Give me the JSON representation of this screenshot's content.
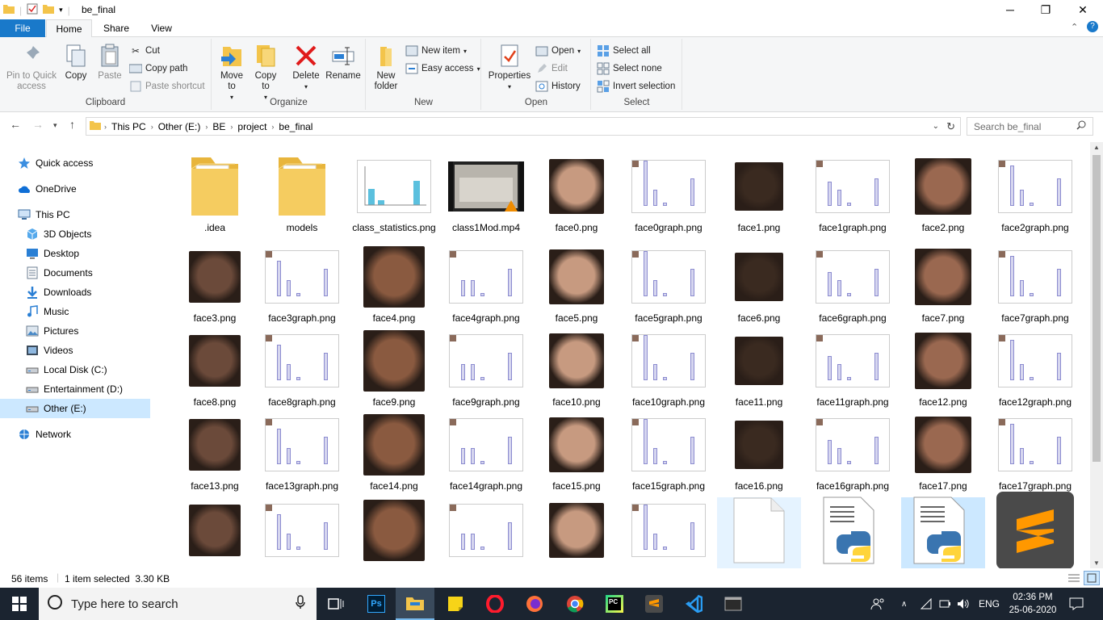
{
  "window": {
    "title": "be_final",
    "minimize": "─",
    "restore": "❐",
    "close": "✕"
  },
  "tabs": [
    {
      "label": "File"
    },
    {
      "label": "Home"
    },
    {
      "label": "Share"
    },
    {
      "label": "View"
    }
  ],
  "ribbon": {
    "clipboard": {
      "group_label": "Clipboard",
      "pin": "Pin to Quick access",
      "copy": "Copy",
      "paste": "Paste",
      "cut": "Cut",
      "copy_path": "Copy path",
      "paste_shortcut": "Paste shortcut"
    },
    "organize": {
      "group_label": "Organize",
      "move_to": "Move to",
      "copy_to": "Copy to",
      "delete": "Delete",
      "rename": "Rename"
    },
    "new": {
      "group_label": "New",
      "new_folder": "New folder",
      "new_item": "New item",
      "easy_access": "Easy access"
    },
    "open": {
      "group_label": "Open",
      "properties": "Properties",
      "open": "Open",
      "edit": "Edit",
      "history": "History"
    },
    "select": {
      "group_label": "Select",
      "select_all": "Select all",
      "select_none": "Select none",
      "invert": "Invert selection"
    }
  },
  "address": {
    "crumbs": [
      "This PC",
      "Other (E:)",
      "BE",
      "project",
      "be_final"
    ],
    "search_placeholder": "Search be_final"
  },
  "nav": [
    {
      "label": "Quick access",
      "icon": "star-icon"
    },
    {
      "label": "OneDrive",
      "icon": "cloud-icon"
    },
    {
      "label": "This PC",
      "icon": "computer-icon"
    },
    {
      "label": "3D Objects",
      "icon": "cube-icon"
    },
    {
      "label": "Desktop",
      "icon": "desktop-icon"
    },
    {
      "label": "Documents",
      "icon": "documents-icon"
    },
    {
      "label": "Downloads",
      "icon": "download-icon"
    },
    {
      "label": "Music",
      "icon": "music-icon"
    },
    {
      "label": "Pictures",
      "icon": "pictures-icon"
    },
    {
      "label": "Videos",
      "icon": "videos-icon"
    },
    {
      "label": "Local Disk (C:)",
      "icon": "drive-icon"
    },
    {
      "label": "Entertainment (D:)",
      "icon": "drive-icon"
    },
    {
      "label": "Other (E:)",
      "icon": "drive-icon"
    },
    {
      "label": "Network",
      "icon": "network-icon"
    }
  ],
  "files": [
    {
      "name": ".idea",
      "kind": "folder"
    },
    {
      "name": "models",
      "kind": "folder"
    },
    {
      "name": "class_statistics.png",
      "kind": "chart"
    },
    {
      "name": "class1Mod.mp4",
      "kind": "video"
    },
    {
      "name": "face0.png",
      "kind": "face"
    },
    {
      "name": "face0graph.png",
      "kind": "graph"
    },
    {
      "name": "face1.png",
      "kind": "face"
    },
    {
      "name": "face1graph.png",
      "kind": "graph"
    },
    {
      "name": "face2.png",
      "kind": "face"
    },
    {
      "name": "face2graph.png",
      "kind": "graph"
    },
    {
      "name": "face3.png",
      "kind": "face"
    },
    {
      "name": "face3graph.png",
      "kind": "graph"
    },
    {
      "name": "face4.png",
      "kind": "face"
    },
    {
      "name": "face4graph.png",
      "kind": "graph"
    },
    {
      "name": "face5.png",
      "kind": "face"
    },
    {
      "name": "face5graph.png",
      "kind": "graph"
    },
    {
      "name": "face6.png",
      "kind": "face"
    },
    {
      "name": "face6graph.png",
      "kind": "graph"
    },
    {
      "name": "face7.png",
      "kind": "face"
    },
    {
      "name": "face7graph.png",
      "kind": "graph"
    },
    {
      "name": "face8.png",
      "kind": "face"
    },
    {
      "name": "face8graph.png",
      "kind": "graph"
    },
    {
      "name": "face9.png",
      "kind": "face"
    },
    {
      "name": "face9graph.png",
      "kind": "graph"
    },
    {
      "name": "face10.png",
      "kind": "face"
    },
    {
      "name": "face10graph.png",
      "kind": "graph"
    },
    {
      "name": "face11.png",
      "kind": "face"
    },
    {
      "name": "face11graph.png",
      "kind": "graph"
    },
    {
      "name": "face12.png",
      "kind": "face"
    },
    {
      "name": "face12graph.png",
      "kind": "graph"
    },
    {
      "name": "face13.png",
      "kind": "face"
    },
    {
      "name": "face13graph.png",
      "kind": "graph"
    },
    {
      "name": "face14.png",
      "kind": "face"
    },
    {
      "name": "face14graph.png",
      "kind": "graph"
    },
    {
      "name": "face15.png",
      "kind": "face"
    },
    {
      "name": "face15graph.png",
      "kind": "graph"
    },
    {
      "name": "face16.png",
      "kind": "face"
    },
    {
      "name": "face16graph.png",
      "kind": "graph"
    },
    {
      "name": "face17.png",
      "kind": "face"
    },
    {
      "name": "face17graph.png",
      "kind": "graph"
    },
    {
      "name": "",
      "kind": "face"
    },
    {
      "name": "",
      "kind": "graph"
    },
    {
      "name": "",
      "kind": "face"
    },
    {
      "name": "",
      "kind": "graph"
    },
    {
      "name": "",
      "kind": "face"
    },
    {
      "name": "",
      "kind": "graph"
    },
    {
      "name": "",
      "kind": "blank"
    },
    {
      "name": "",
      "kind": "python"
    },
    {
      "name": "",
      "kind": "python"
    },
    {
      "name": "",
      "kind": "sublime"
    }
  ],
  "status": {
    "count": "56 items",
    "selected": "1 item selected  3.30 KB"
  },
  "taskbar": {
    "search_placeholder": "Type here to search",
    "lang": "ENG",
    "time": "02:36 PM",
    "date": "25-06-2020"
  },
  "colors": {
    "accent": "#1979ca",
    "selection": "#cce8ff",
    "taskbar": "#1b2430"
  }
}
